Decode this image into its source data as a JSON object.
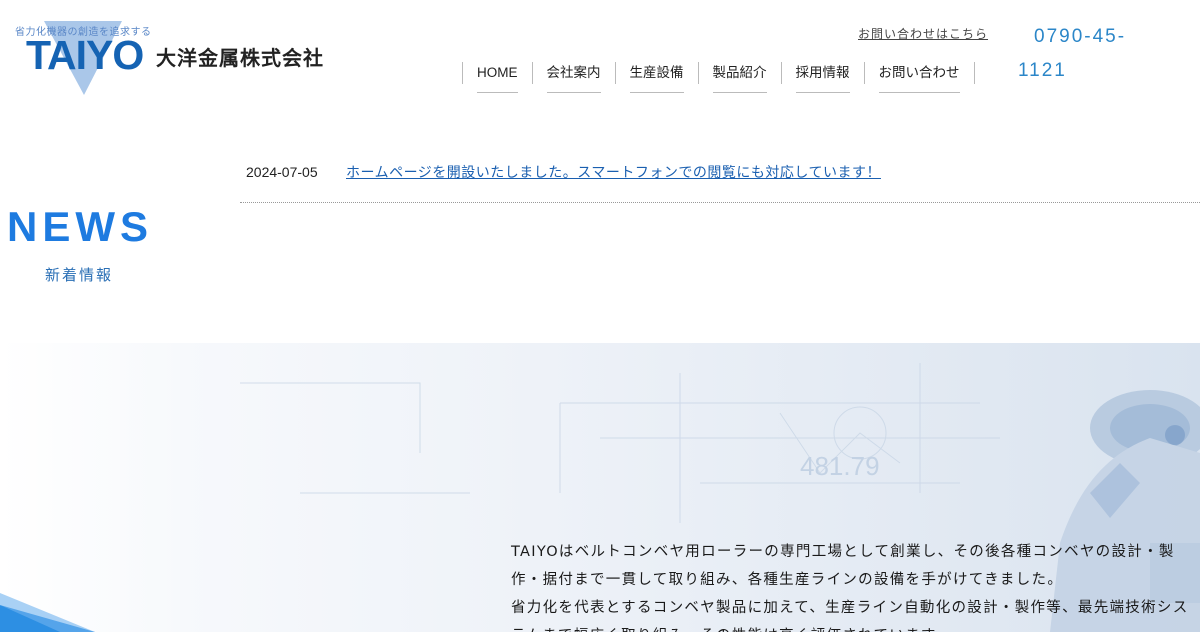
{
  "header": {
    "logo_tagline": "省力化機器の創造を追求する",
    "logo_word": "TAIYO",
    "company_name": "大洋金属株式会社",
    "contact_link": "お問い合わせはこちら",
    "phone_line1": "0790-45-",
    "phone_line2": "1121"
  },
  "nav": {
    "items": [
      {
        "label": "HOME"
      },
      {
        "label": "会社案内"
      },
      {
        "label": "生産設備"
      },
      {
        "label": "製品紹介"
      },
      {
        "label": "採用情報"
      },
      {
        "label": "お問い合わせ"
      }
    ]
  },
  "news": {
    "title": "NEWS",
    "subtitle": "新着情報",
    "items": [
      {
        "date": "2024-07-05",
        "text": "ホームページを開設いたしました。スマートフォンでの閲覧にも対応しています！"
      }
    ]
  },
  "hero": {
    "digits": "481.79",
    "paragraph": [
      "TAIYOはベルトコンベヤ用ローラーの専門工場として創業し、その後各種コンベヤの設計・製",
      "作・据付まで一貫して取り組み、各種生産ラインの設備を手がけてきました。",
      "省力化を代表とするコンベヤ製品に加えて、生産ライン自動化の設計・製作等、最先端技術シス",
      "テムまで幅広く取り組み、その性能は高く評価されています。"
    ]
  },
  "colors": {
    "brand_blue": "#1563b3",
    "news_blue": "#1e7be0",
    "phone_blue": "#2b86c8",
    "link_blue": "#1a5fb0"
  }
}
